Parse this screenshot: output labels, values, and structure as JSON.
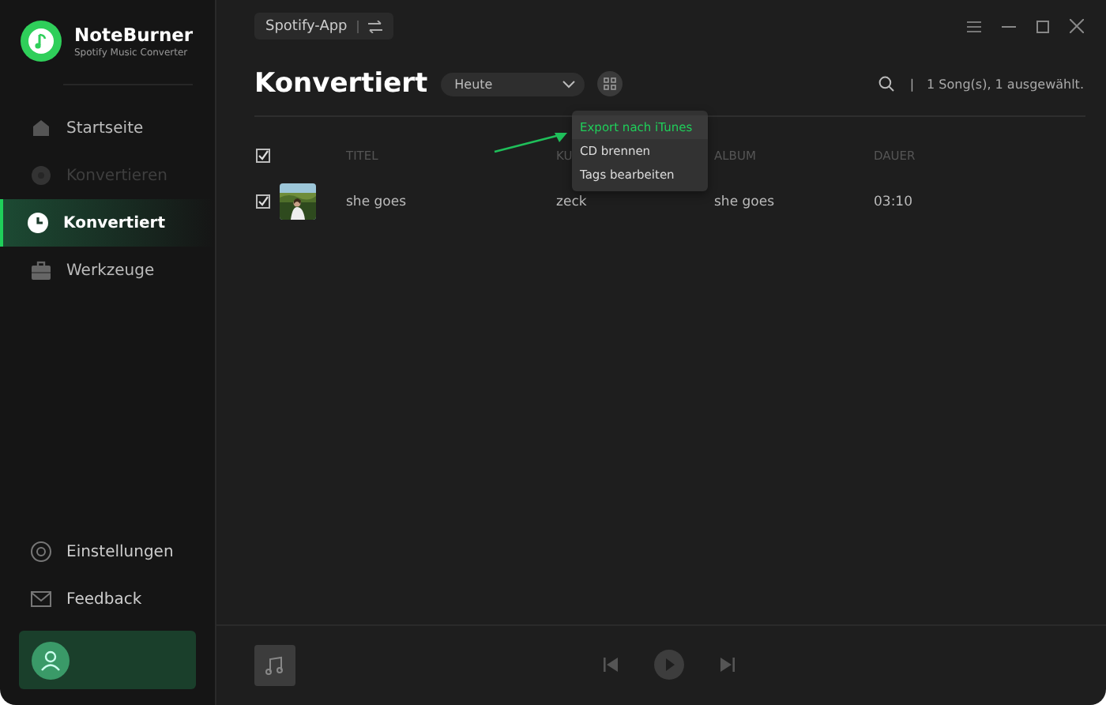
{
  "app": {
    "name": "NoteBurner",
    "subtitle": "Spotify Music Converter"
  },
  "sidebar": {
    "items": [
      {
        "label": "Startseite",
        "selected": false,
        "disabled": false
      },
      {
        "label": "Konvertieren",
        "selected": false,
        "disabled": true
      },
      {
        "label": "Konvertiert",
        "selected": true,
        "disabled": false
      },
      {
        "label": "Werkzeuge",
        "selected": false,
        "disabled": false
      }
    ],
    "bottom_items": [
      {
        "label": "Einstellungen"
      },
      {
        "label": "Feedback"
      }
    ]
  },
  "source_button": {
    "label": "Spotify-App"
  },
  "page": {
    "title": "Konvertiert",
    "filter": "Heute",
    "separator": "|",
    "summary": "1 Song(s), 1 ausgewählt."
  },
  "table": {
    "columns": [
      "TITEL",
      "KU",
      "ALBUM",
      "DAUER"
    ],
    "all_checked": true,
    "rows": [
      {
        "checked": true,
        "cells": [
          "she goes",
          "zeck",
          "she goes",
          "03:10"
        ]
      }
    ]
  },
  "menu": {
    "items": [
      {
        "label": "Export nach iTunes",
        "selected": true
      },
      {
        "label": "CD brennen",
        "selected": false
      },
      {
        "label": "Tags bearbeiten",
        "selected": false
      }
    ]
  }
}
